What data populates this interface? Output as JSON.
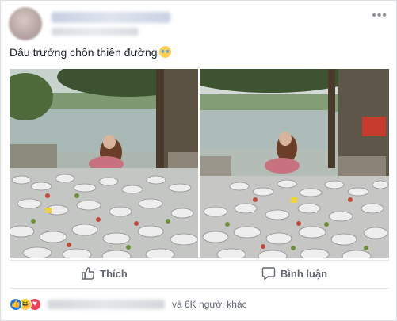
{
  "post": {
    "caption": "Dâu trưởng chốn thiên đường",
    "caption_emoji": "crying-face-emoji"
  },
  "header": {
    "more_label": "•••"
  },
  "photos": [
    {
      "name": "left-photo"
    },
    {
      "name": "right-photo"
    }
  ],
  "actions": {
    "like_label": "Thích",
    "comment_label": "Bình luận"
  },
  "reactions": {
    "icons": [
      "like",
      "haha",
      "love"
    ],
    "others_text": "và 6K người khác"
  },
  "colors": {
    "accent": "#1877f2",
    "text_secondary": "#606770",
    "love": "#f33e58",
    "haha": "#ffcc4d"
  }
}
